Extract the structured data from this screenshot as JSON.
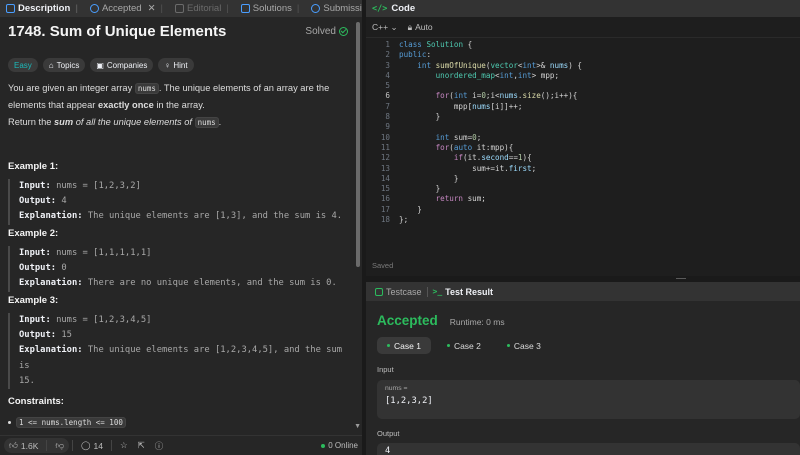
{
  "left_tabs": [
    {
      "label": "Description",
      "active": true
    },
    {
      "label": "Accepted",
      "closable": true
    },
    {
      "label": "Editorial",
      "dim": true
    },
    {
      "label": "Solutions"
    },
    {
      "label": "Submissions"
    }
  ],
  "problem": {
    "title": "1748. Sum of Unique Elements",
    "status": "Solved",
    "tags": [
      "Easy",
      "Topics",
      "Companies",
      "Hint"
    ],
    "desc_1a": "You are given an integer array ",
    "desc_code": "nums",
    "desc_1b": ". The unique elements of an array are the elements that appear ",
    "desc_bold": "exactly once",
    "desc_1c": " in the array.",
    "desc_2a": "Return the ",
    "desc_2b": "sum",
    "desc_2c": " of all the unique elements of ",
    "desc_2d": "nums",
    "desc_2e": "."
  },
  "examples": [
    {
      "title": "Example 1:",
      "input": "nums = [1,2,3,2]",
      "output": "4",
      "explanation": "The unique elements are [1,3], and the sum is 4."
    },
    {
      "title": "Example 2:",
      "input": "nums = [1,1,1,1,1]",
      "output": "0",
      "explanation": "There are no unique elements, and the sum is 0."
    },
    {
      "title": "Example 3:",
      "input": "nums = [1,2,3,4,5]",
      "output": "15",
      "explanation": "The unique elements are [1,2,3,4,5], and the sum is",
      "explanation_cont": "15."
    }
  ],
  "labels": {
    "input": "Input:",
    "output": "Output:",
    "explanation": "Explanation:"
  },
  "constraints": {
    "title": "Constraints:",
    "items": [
      "1 <= nums.length <= 100"
    ]
  },
  "footer": {
    "likes": "1.6K",
    "comments": "14",
    "online": "0 Online"
  },
  "code_panel": {
    "title": "Code",
    "language": "C++",
    "auto_label": "Auto",
    "saved": "Saved",
    "current_line": 6
  },
  "test_panel": {
    "tabs": [
      "Testcase",
      "Test Result"
    ],
    "verdict": "Accepted",
    "runtime": "Runtime: 0 ms",
    "cases": [
      "Case 1",
      "Case 2",
      "Case 3"
    ],
    "input_label": "Input",
    "input_var": "nums =",
    "input_value": "[1,2,3,2]",
    "output_label": "Output",
    "output_value": "4"
  },
  "colors": {
    "accent": "#2cbb5d",
    "easy": "#1cbaba",
    "keyword": "#569cd6"
  }
}
